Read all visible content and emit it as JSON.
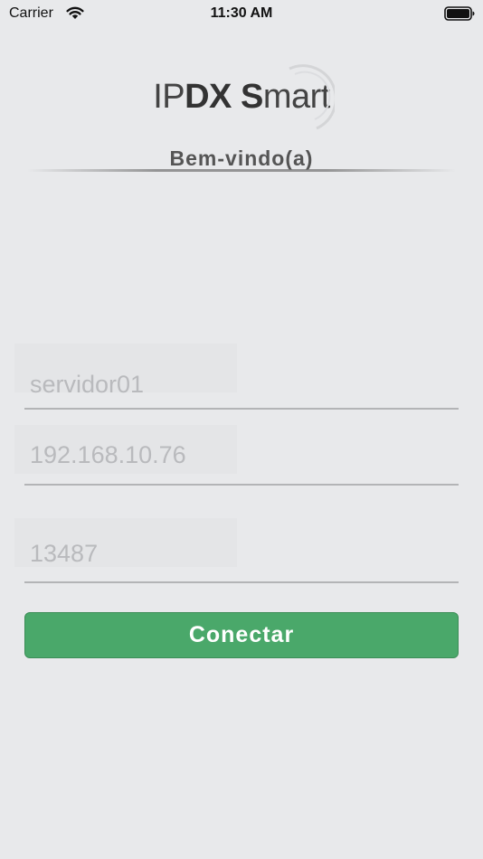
{
  "status_bar": {
    "carrier": "Carrier",
    "time": "11:30 AM"
  },
  "logo": {
    "part1": "IP",
    "part2": "DX",
    "part3": "S",
    "part4": "mart"
  },
  "welcome": "Bem-vindo(a)",
  "fields": {
    "server": {
      "value": "servidor01"
    },
    "ip": {
      "value": "192.168.10.76"
    },
    "port": {
      "value": "13487"
    }
  },
  "connect_button": {
    "label": "Conectar"
  },
  "colors": {
    "background": "#e8e9eb",
    "accent": "#4aa86a"
  },
  "icons": {
    "wifi": "wifi-icon",
    "battery": "battery-icon"
  }
}
